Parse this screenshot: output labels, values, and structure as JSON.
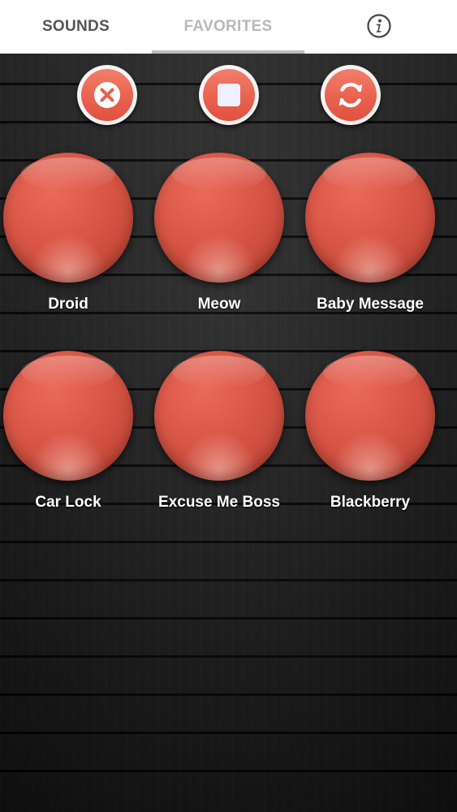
{
  "tabs": {
    "sounds": "SOUNDS",
    "favorites": "FAVORITES",
    "active": "favorites"
  },
  "icons": {
    "info": "info-icon",
    "cancel": "close-icon",
    "stop": "stop-icon",
    "repeat": "repeat-icon"
  },
  "colors": {
    "accent": "#e8604d",
    "button_red": "#d95646",
    "tab_active": "#b9b9b9",
    "tab_inactive": "#555555"
  },
  "sounds": [
    {
      "label": "Droid"
    },
    {
      "label": "Meow"
    },
    {
      "label": "Baby Message"
    },
    {
      "label": "Car Lock"
    },
    {
      "label": "Excuse Me Boss"
    },
    {
      "label": "Blackberry"
    }
  ]
}
